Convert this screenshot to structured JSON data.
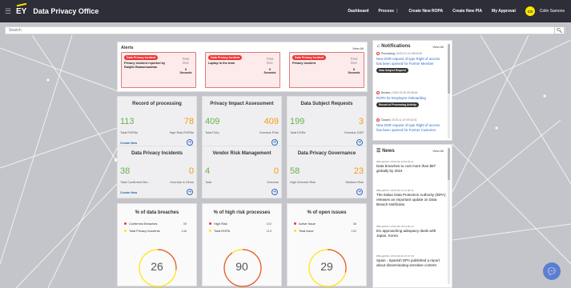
{
  "header": {
    "menu_icon": "hamburger-icon",
    "logo": "EY",
    "title": "Data Privacy Office",
    "nav": [
      "Dashboard",
      "Process",
      "Create New ROPA",
      "Create New PIA",
      "My Approval"
    ],
    "user_initials": "CS",
    "user_name": "Colin Samons"
  },
  "search": {
    "placeholder": "Search",
    "icon": "search-icon"
  },
  "alerts": {
    "title": "Alerts",
    "view_all": "View All",
    "items": [
      {
        "badge": "Data Privacy Incident",
        "text": "Privacy incident reported by Ranjith Ramachandran",
        "due_label": "Past Due",
        "count": "0",
        "unit": "Seconds"
      },
      {
        "badge": "Data Privacy Incident",
        "text": "Laptop in the train",
        "due_label": "Past Due",
        "count": "0",
        "unit": "Seconds"
      },
      {
        "badge": "Data Privacy Incident",
        "text": "Privacy incident",
        "due_label": "Past Due",
        "count": "0",
        "unit": "Seconds"
      }
    ]
  },
  "cards": [
    {
      "title": "Record of processing",
      "v1": "113",
      "v2": "78",
      "l1": "Total ROPAs",
      "l2": "High Risk ROPAs",
      "create": "Create New"
    },
    {
      "title": "Privacy Impact Assessment",
      "v1": "409",
      "v2": "409",
      "l1": "Total PIAs",
      "l2": "Overdue PIAs",
      "create": ""
    },
    {
      "title": "Data Subject Requests",
      "v1": "199",
      "v2": "3",
      "l1": "Total DSRs",
      "l2": "Overdue DSR",
      "create": ""
    },
    {
      "title": "Data Privacy Incidents",
      "v1": "38",
      "v2": "0",
      "l1": "Total Confirmed Bre...",
      "l2": "Overdue in 24hrs",
      "create": "Create New"
    },
    {
      "title": "Vendor Risk Management",
      "v1": "4",
      "v2": "0",
      "l1": "Total",
      "l2": "Overdue",
      "create": ""
    },
    {
      "title": "Data Privacy Governance",
      "v1": "58",
      "v2": "23",
      "l1": "High Inherent Risk",
      "l2": "Medium Risk",
      "create": ""
    }
  ],
  "percent_cards": [
    {
      "title": "% of data breaches",
      "r1": "Confirmed Breaches",
      "r1v": "39",
      "r2": "Total Privacy Incidents",
      "r2v": "146",
      "value": "26",
      "fraction": 0.267
    },
    {
      "title": "% of high risk processes",
      "r1": "High Risk",
      "r1v": "102",
      "r2": "Total ROPA",
      "r2v": "113",
      "value": "90",
      "fraction": 0.903
    },
    {
      "title": "% of open issues",
      "r1": "Active Issue",
      "r1v": "38",
      "r2": "Total Issue",
      "r2v": "132",
      "value": "29",
      "fraction": 0.288
    }
  ],
  "notifications": {
    "title": "Notifications",
    "view_all": "View All",
    "items": [
      {
        "status": "Processing",
        "date": "2020-01-24 08:04:05",
        "text": "New DSR request of type Right of access has been opened for Former Member",
        "tag": "Data Subject Request"
      },
      {
        "status": "Review",
        "date": "2019-09-30 09:08:46",
        "text": "ROPA for Employee Onboarding",
        "tag": "Record of Processing Activity"
      },
      {
        "status": "Closed",
        "date": "2019-11-19 09:33:51",
        "text": "New DSR request of type Right of access has been opened for Former Customer",
        "tag": ""
      }
    ]
  },
  "news": {
    "title": "News",
    "view_all": "View All",
    "items": [
      {
        "source": "RBlog2020",
        "date": "2019-09-19 09:40:11",
        "text": "Data breaches to cost more than $5T globally by 2024"
      },
      {
        "source": "RBlog2019",
        "date": "2019-09-12 12:38:11",
        "text": "The Italian Data Protection Authority (IDPA) releases an important update on Data Breach Notificatio"
      },
      {
        "source": "RBlog2015",
        "date": "2019-09-15 04:50:12",
        "text": "EU approaching adequacy deals with Japan, Korea"
      },
      {
        "source": "RBlog2004",
        "date": "2019-09-09 15:47:38",
        "text": "Spain - Spanish DPA published a report about disseminating sensitive content"
      }
    ]
  },
  "colors": {
    "accent": "#ffe600",
    "topbar": "#2e2e38",
    "green": "#6ab04c",
    "orange": "#f39c12",
    "link": "#2e6bc4",
    "alert": "#e33333"
  }
}
